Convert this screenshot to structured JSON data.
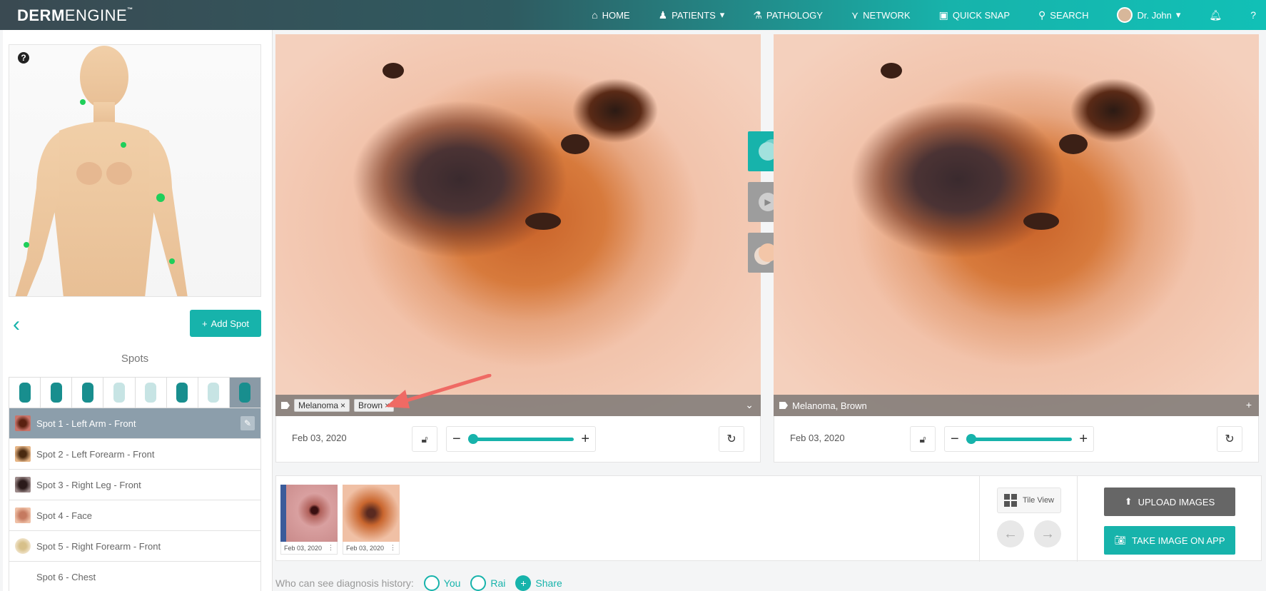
{
  "brand": {
    "bold": "DERM",
    "thin": "ENGINE",
    "tm": "™"
  },
  "nav": {
    "home": "HOME",
    "patients": "PATIENTS",
    "pathology": "PATHOLOGY",
    "network": "NETWORK",
    "quick_snap": "QUICK SNAP",
    "search": "SEARCH",
    "user": "Dr. John"
  },
  "sidebar": {
    "add_spot": "Add Spot",
    "spots_title": "Spots",
    "spots": [
      {
        "label": "Spot 1 - Left Arm - Front"
      },
      {
        "label": "Spot 2 - Left Forearm - Front"
      },
      {
        "label": "Spot 3 - Right Leg - Front"
      },
      {
        "label": "Spot 4 - Face"
      },
      {
        "label": "Spot 5 - Right Forearm - Front"
      },
      {
        "label": "Spot 6 - Chest"
      }
    ]
  },
  "viewer_left": {
    "tags": [
      "Melanoma",
      "Brown"
    ],
    "date": "Feb 03, 2020"
  },
  "viewer_right": {
    "tags_text": "Melanoma, Brown",
    "date": "Feb 03, 2020"
  },
  "thumbnails": [
    {
      "date": "Feb 03, 2020"
    },
    {
      "date": "Feb 03, 2020"
    }
  ],
  "actions": {
    "tile_view": "Tile View",
    "upload": "UPLOAD IMAGES",
    "take_image": "TAKE IMAGE ON APP"
  },
  "diagnosis_history": {
    "label": "Who can see diagnosis history:",
    "you": "You",
    "rai": "Rai",
    "share": "Share"
  },
  "colors": {
    "accent": "#17b3ab",
    "upload": "#666666",
    "active_spot": "#8c9eab"
  }
}
